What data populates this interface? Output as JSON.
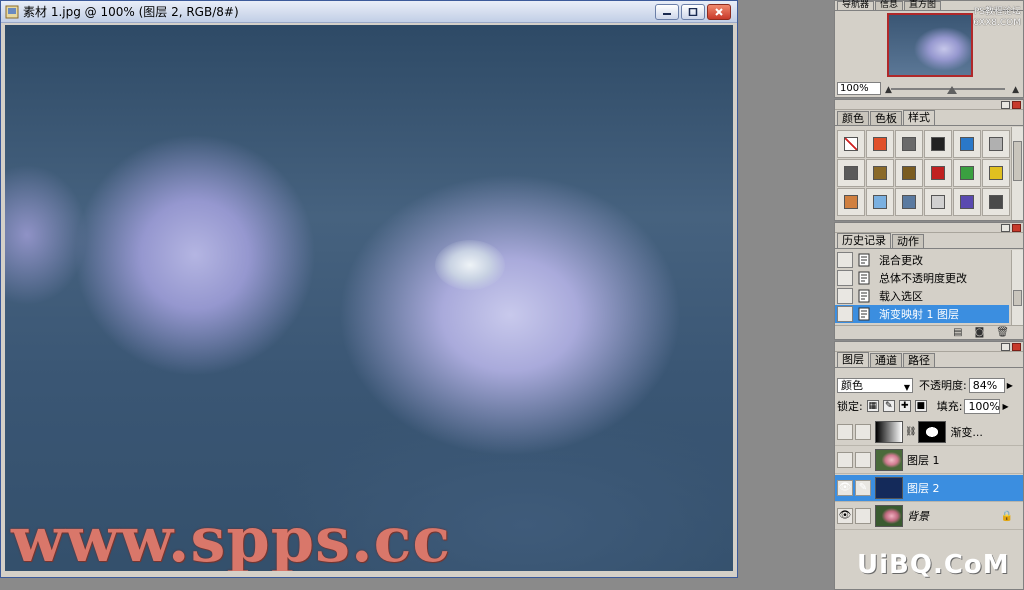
{
  "document": {
    "title": "素材 1.jpg @ 100% (图层 2, RGB/8#)",
    "watermark": "www.spps.cc"
  },
  "navigator": {
    "tabs": [
      "导航器",
      "信息",
      "直方图"
    ],
    "zoom": "100%",
    "site_watermark_1": "PS教程论坛",
    "site_watermark_2": "BBS.16XX8.COM"
  },
  "styles_panel": {
    "tabs": [
      "颜色",
      "色板",
      "样式"
    ],
    "swatches": [
      "#ffffff",
      "#e0502a",
      "#6a6a6a",
      "#222222",
      "#2a78c8",
      "#b0b0b0",
      "#5a5a5a",
      "#8a6a2a",
      "#7a5c20",
      "#c02020",
      "#3aa040",
      "#e0c020",
      "#d08040",
      "#7ab0e0",
      "#5a7aa0",
      "#d0d0d0",
      "#5a4ab0",
      "#4a4a4a"
    ]
  },
  "history": {
    "tabs": [
      "历史记录",
      "动作"
    ],
    "items": [
      "混合更改",
      "总体不透明度更改",
      "载入选区",
      "渐变映射 1 图层"
    ]
  },
  "layers": {
    "tabs": [
      "图层",
      "通道",
      "路径"
    ],
    "blend_mode": "颜色",
    "opacity_label": "不透明度:",
    "opacity_value": "84%",
    "lock_label": "锁定:",
    "fill_label": "填充:",
    "fill_value": "100%",
    "items": [
      {
        "name": "渐变...",
        "eye": ""
      },
      {
        "name": "图层 1",
        "eye": ""
      },
      {
        "name": "图层 2",
        "eye": "👁"
      },
      {
        "name": "背景",
        "eye": "👁"
      }
    ]
  },
  "brand": "UiBQ.CoM",
  "colors": {
    "selection": "#3b8ee0",
    "panel_bg": "#d4d0c8",
    "watermark": "#d9776a"
  }
}
